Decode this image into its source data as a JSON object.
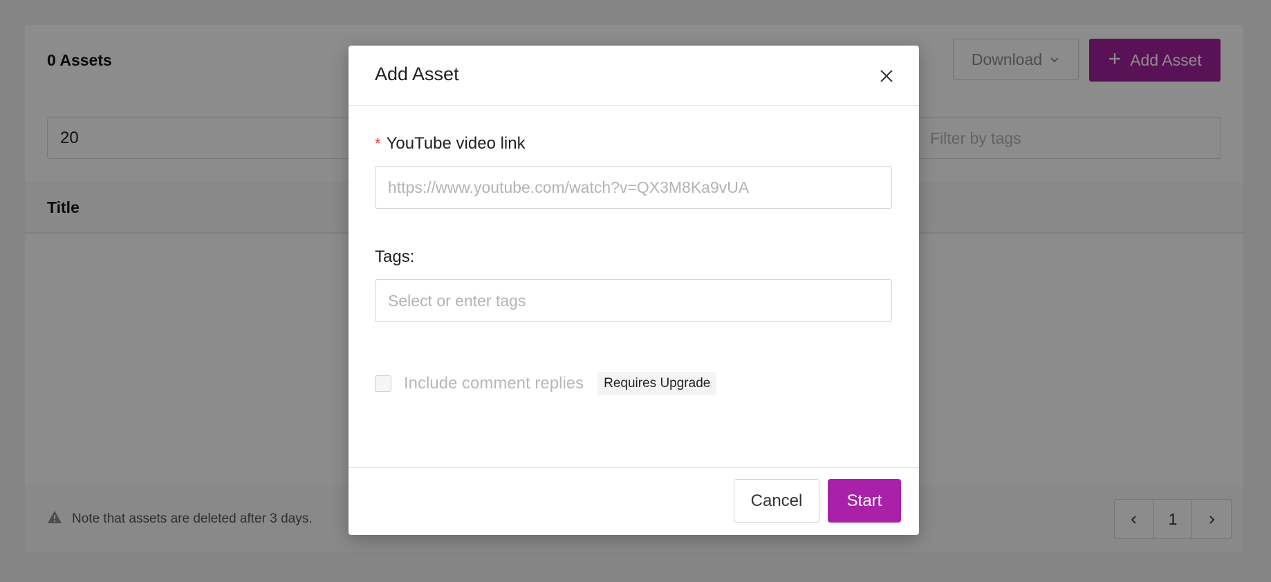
{
  "header": {
    "assets_count": "0 Assets",
    "download_label": "Download",
    "add_asset_label": "Add Asset"
  },
  "filters": {
    "page_size_value": "20",
    "tags_placeholder": "Filter by tags"
  },
  "table": {
    "columns": [
      "Title"
    ]
  },
  "footer": {
    "note": "Note that assets are deleted after 3 days.",
    "current_page": "1"
  },
  "modal": {
    "title": "Add Asset",
    "youtube_field": {
      "required_mark": "*",
      "label": "YouTube video link",
      "placeholder": "https://www.youtube.com/watch?v=QX3M8Ka9vUA",
      "value": ""
    },
    "tags_field": {
      "label": "Tags",
      "placeholder": "Select or enter tags",
      "value": ""
    },
    "comment_replies": {
      "label": "Include comment replies",
      "checked": false,
      "disabled": true,
      "badge": "Requires Upgrade"
    },
    "cancel_label": "Cancel",
    "start_label": "Start"
  },
  "colors": {
    "accent": "#a821a8",
    "required": "#e53935",
    "overlay": "rgba(0,0,0,0.45)"
  },
  "icons": {
    "download_chevron": "chevron-down-icon",
    "add": "plus-icon",
    "close": "close-icon",
    "warning": "warning-icon",
    "prev": "chevron-left-icon",
    "next": "chevron-right-icon"
  }
}
